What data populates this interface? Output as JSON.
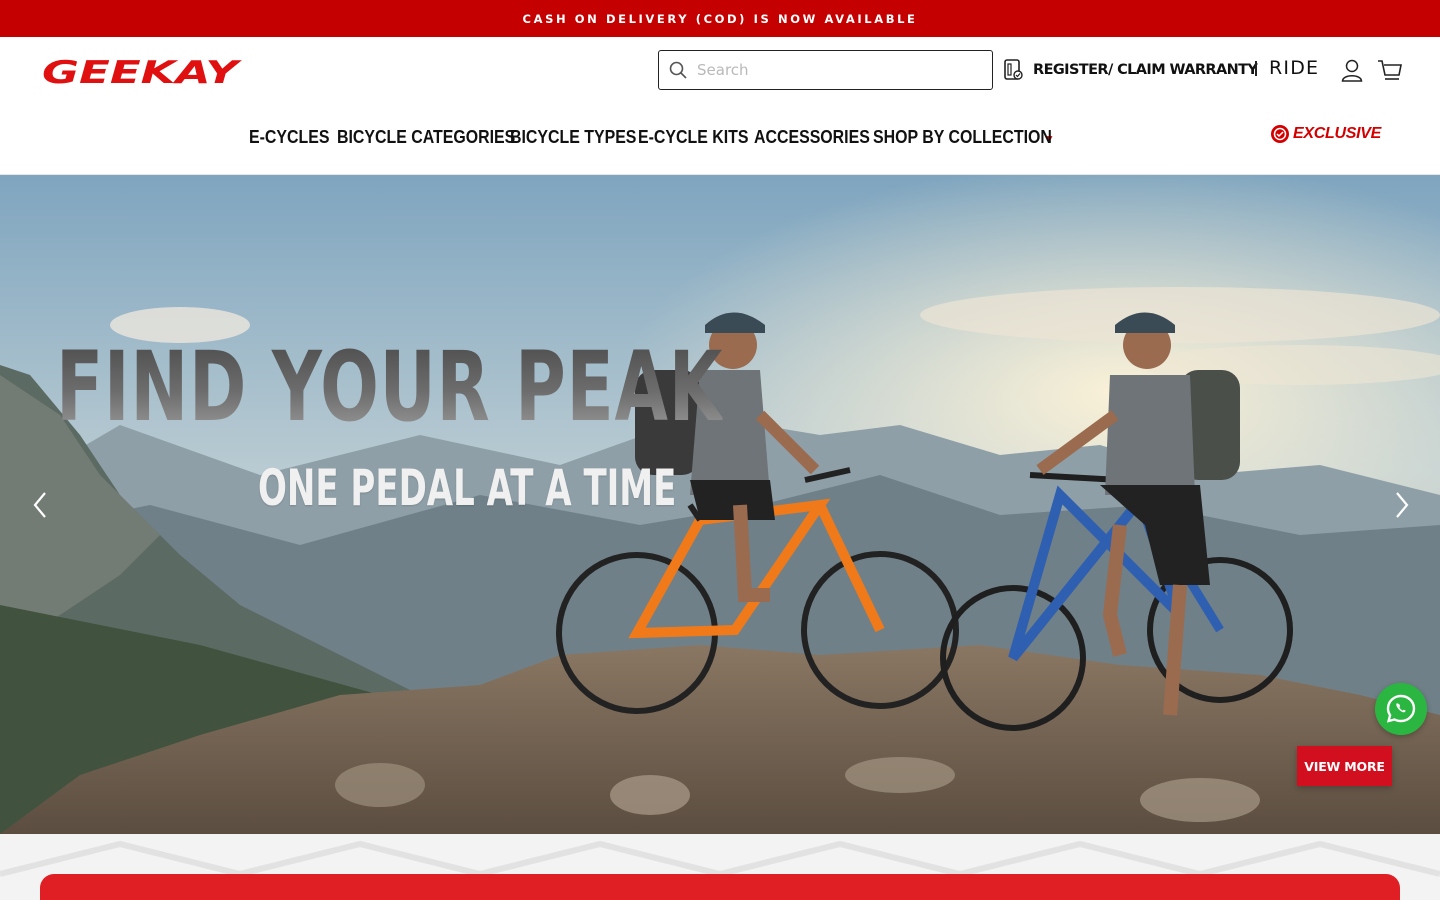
{
  "announcement": {
    "text": "CASH ON DELIVERY (COD) IS NOW AVAILABLE"
  },
  "header": {
    "logo_text": "GEEKAY",
    "search": {
      "placeholder": "Search",
      "value": ""
    },
    "warranty_link": "REGISTER/ CLAIM WARRANTY",
    "ride_link": "RIDE",
    "icons": [
      "search-icon",
      "warranty-icon",
      "account-icon",
      "cart-icon"
    ]
  },
  "nav": {
    "items": [
      {
        "label": "E-CYCLES"
      },
      {
        "label": "BICYCLE CATEGORIES"
      },
      {
        "label": "BICYCLE TYPES"
      },
      {
        "label": "E-CYCLE KITS"
      },
      {
        "label": "ACCESSORIES"
      },
      {
        "label": "SHOP BY COLLECTION"
      }
    ],
    "more_caret": "▼",
    "exclusive_label": "EXCLUSIVE"
  },
  "hero": {
    "headline": "FIND YOUR PEAK",
    "subheadline": "ONE PEDAL AT A TIME",
    "cta_label": "VIEW MORE",
    "prev_icon": "chevron-left-icon",
    "next_icon": "chevron-right-icon"
  },
  "floating": {
    "whatsapp_icon": "whatsapp-icon"
  },
  "colors": {
    "brand_red": "#c40000",
    "accent_red": "#d10f1f",
    "whatsapp_green": "#2ab640"
  }
}
